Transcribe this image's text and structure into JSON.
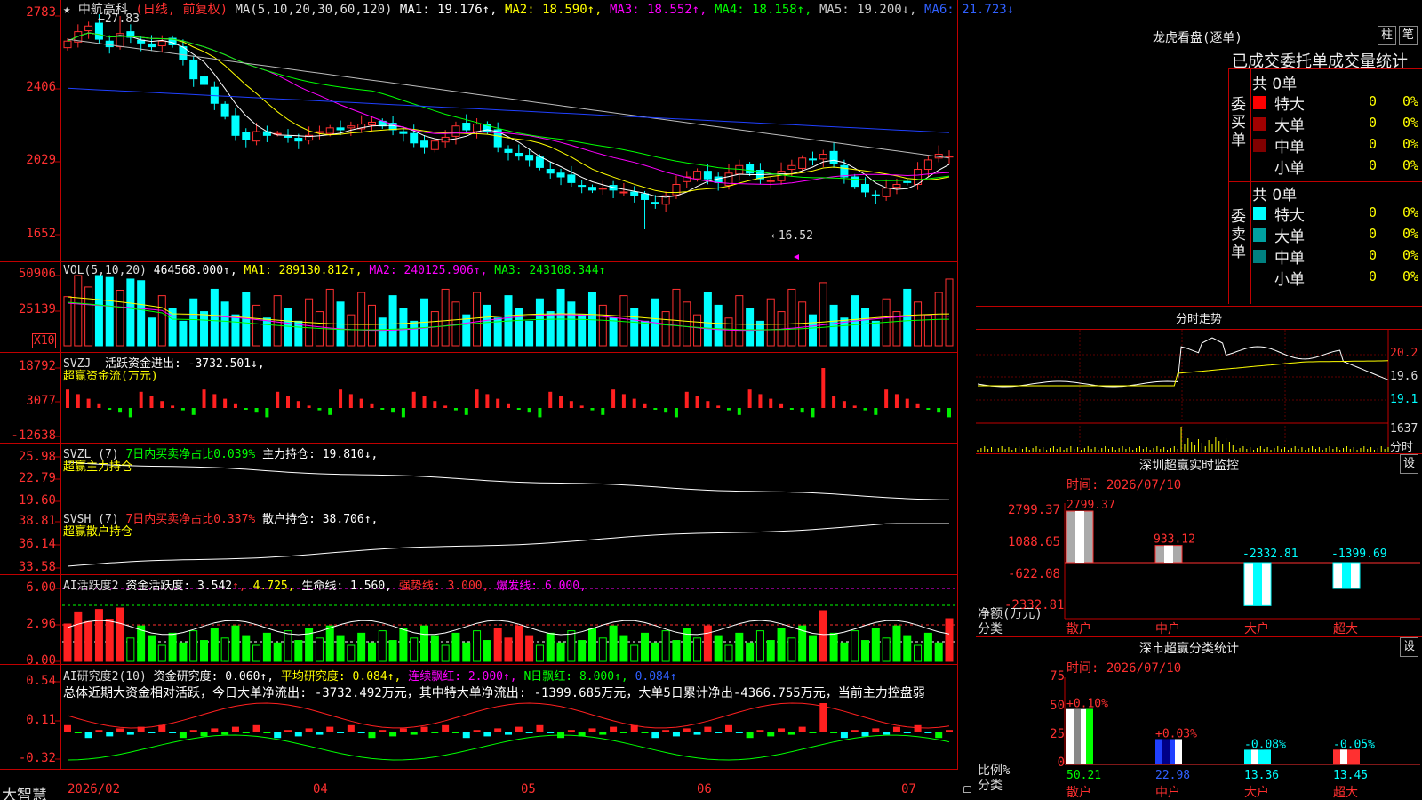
{
  "stock": {
    "name": "中航高科",
    "mode": "(日线, 前复权)",
    "star": "★"
  },
  "main_header": {
    "ma_params": "MA(5,10,20,30,60,120)",
    "ma1": "MA1: 19.176↑,",
    "ma2": "MA2: 18.590↑,",
    "ma3": "MA3: 18.552↑,",
    "ma4": "MA4: 18.158↑,",
    "ma5": "MA5: 19.200↓,",
    "ma6": "MA6: 21.723↓"
  },
  "main_axis": {
    "t1": "2783",
    "t2": "2406",
    "t3": "2029",
    "t4": "1652"
  },
  "annotations": {
    "high": "←27.83",
    "low": "←16.52"
  },
  "vol_header": {
    "params": "VOL(5,10,20)",
    "v": "464568.000↑,",
    "ma1": "MA1: 289130.812↑,",
    "ma2": "MA2: 240125.906↑,",
    "ma3": "MA3: 243108.344↑"
  },
  "vol_axis": {
    "t1": "50906",
    "t2": "25139",
    "unit": "X10"
  },
  "svzj": {
    "name": "SVZJ",
    "label": "活跃资金进出: -3732.501↓,",
    "sub": "超赢资金流(万元)",
    "t1": "18792",
    "t2": "3077",
    "t3": "-12638"
  },
  "svzl": {
    "name": "SVZL (7)",
    "ratio": "7日内买卖净占比0.039%",
    "hold": "主力持仓: 19.810↓,",
    "sub": "超赢主力持仓",
    "t1": "25.98",
    "t2": "22.79",
    "t3": "19.60"
  },
  "svsh": {
    "name": "SVSH (7)",
    "ratio": "7日内买卖净占比0.337%",
    "hold": "散户持仓: 38.706↑,",
    "sub": "超赢散户持仓",
    "t1": "38.81",
    "t2": "36.14",
    "t3": "33.58"
  },
  "ai1": {
    "name": "AI活跃度2",
    "a": "资金活跃度: 3.542",
    "b": "4.725,",
    "c": "生命线: 1.560,",
    "d": "强势线: 3.000,",
    "e": "爆发线: 6.000,",
    "t1": "6.00",
    "t2": "2.96",
    "t3": "0.00"
  },
  "ai2": {
    "name": "AI研究度2(10)",
    "a": "资金研究度: 0.060↑,",
    "b": "平均研究度: 0.084↑,",
    "c": "连续飘红: 2.000↑,",
    "d": "N日飘红: 8.000↑,",
    "e": "0.084↑",
    "summary": "总体近期大资金相对活跃，今日大单净流出: -3732.492万元，其中特大单净流出: -1399.685万元，大单5日累计净出-4366.755万元，当前主力控盘弱",
    "t1": "0.54",
    "t2": "0.11",
    "t3": "-0.32"
  },
  "x_axis": {
    "m1": "2026/02",
    "m2": "04",
    "m3": "05",
    "m4": "06",
    "m5": "07"
  },
  "brand": "大智慧",
  "lhb": {
    "title": "龙虎看盘(逐单)",
    "btn1": "柱",
    "btn2": "笔",
    "tabs": "已成交委托单成交量统计",
    "buy": {
      "side": "委买单",
      "total": "共 0单",
      "rows": [
        {
          "k": "特大",
          "n": "0",
          "p": "0%"
        },
        {
          "k": "大单",
          "n": "0",
          "p": "0%"
        },
        {
          "k": "中单",
          "n": "0",
          "p": "0%"
        },
        {
          "k": "小单",
          "n": "0",
          "p": "0%"
        }
      ]
    },
    "sell": {
      "side": "委卖单",
      "total": "共 0单",
      "rows": [
        {
          "k": "特大",
          "n": "0",
          "p": "0%"
        },
        {
          "k": "大单",
          "n": "0",
          "p": "0%"
        },
        {
          "k": "中单",
          "n": "0",
          "p": "0%"
        },
        {
          "k": "小单",
          "n": "0",
          "p": "0%"
        }
      ]
    }
  },
  "intraday": {
    "title": "分时走势",
    "p1": "20.2",
    "p2": "19.6",
    "p3": "19.1",
    "v": "1637",
    "unit": "分时"
  },
  "sz_monitor": {
    "title": "深圳超赢实时监控",
    "btn": "设",
    "time": "时间: 2026/07/10",
    "t1": "2799.37",
    "t2": "1088.65",
    "t3": "-622.08",
    "t4": "-2332.81",
    "ylabel": "净额(万元)",
    "xlabel": "分类",
    "cats": [
      "散户",
      "中户",
      "大户",
      "超大"
    ],
    "values": [
      "2799.37",
      "933.12",
      "-2332.81",
      "-1399.69"
    ]
  },
  "sz_stats": {
    "title": "深市超赢分类统计",
    "btn": "设",
    "time": "时间: 2026/07/10",
    "t1": "75",
    "t2": "50",
    "t3": "25",
    "t4": "0",
    "ylabel": "比例%",
    "xlabel": "分类",
    "cats": [
      "散户",
      "中户",
      "大户",
      "超大"
    ],
    "tops": [
      "+0.10%",
      "+0.03%",
      "-0.08%",
      "-0.05%"
    ],
    "bottoms": [
      "50.21",
      "22.98",
      "13.36",
      "13.45"
    ]
  },
  "chart_data": {
    "type": "candlestick",
    "title": "中航高科 (日线, 前复权)",
    "price_high": 27.83,
    "price_low": 16.52,
    "close_approx": [
      26.5,
      27.0,
      27.3,
      26.6,
      26.2,
      26.9,
      26.7,
      26.4,
      26.2,
      26.5,
      26.3,
      25.5,
      24.5,
      24.2,
      23.2,
      22.5,
      21.5,
      21.3,
      21.7,
      21.5,
      21.6,
      21.4,
      21.2,
      21.5,
      21.7,
      21.9,
      21.8,
      22.0,
      22.1,
      22.2,
      22.0,
      21.8,
      21.6,
      21.1,
      20.9,
      21.2,
      21.4,
      22.0,
      21.8,
      22.1,
      21.7,
      20.9,
      20.6,
      20.4,
      20.2,
      19.8,
      19.5,
      19.3,
      19.0,
      18.8,
      18.6,
      18.7,
      18.6,
      18.5,
      18.3,
      18.1,
      17.9,
      18.3,
      18.9,
      19.3,
      19.6,
      19.2,
      19.0,
      19.5,
      19.9,
      19.5,
      19.2,
      19.1,
      19.6,
      19.9,
      20.3,
      20.2,
      20.5,
      20.0,
      19.3,
      18.8,
      18.5,
      18.3,
      18.7,
      18.9,
      19.0,
      19.7,
      20.2,
      20.5,
      20.4
    ]
  }
}
